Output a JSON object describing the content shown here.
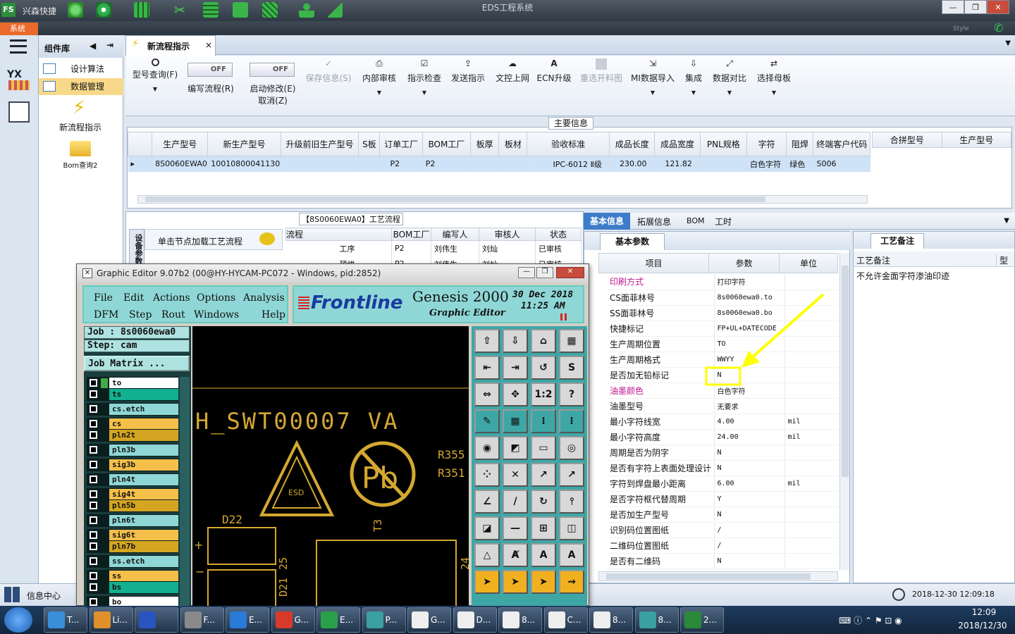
{
  "window": {
    "app_name": "兴森快捷",
    "title": "EDS工程系统",
    "style_label": "Style",
    "min": "—",
    "max": "❐",
    "close": "✕"
  },
  "sysmenu": {
    "label": "系统"
  },
  "left_rail": {
    "logo_text": "YX"
  },
  "component_panel": {
    "title": "组件库",
    "items": [
      {
        "label": "设计算法"
      },
      {
        "label": "数据管理"
      }
    ],
    "shortcuts": [
      {
        "label": "新流程指示"
      },
      {
        "label": "Bom查询2"
      }
    ]
  },
  "tab": {
    "label": "新流程指示",
    "close": "×"
  },
  "toolbar": {
    "buttons": [
      {
        "label": "型号查询(F)"
      },
      {
        "label": "编写流程(R)",
        "toggle": "OFF"
      },
      {
        "label": "启动修改(E)",
        "label2": "取消(Z)",
        "toggle": "OFF"
      },
      {
        "label": "保存信息(S)"
      },
      {
        "label": "内部审核"
      },
      {
        "label": "指示检查"
      },
      {
        "label": "发送指示"
      },
      {
        "label": "文控上网"
      },
      {
        "label": "ECN升级"
      },
      {
        "label": "重选开料图"
      },
      {
        "label": "MI数据导入"
      },
      {
        "label": "集成"
      },
      {
        "label": "数据对比"
      },
      {
        "label": "选择母板"
      }
    ]
  },
  "main_info": {
    "legend": "主要信息",
    "columns": [
      "生产型号",
      "新生产型号",
      "升级前旧生产型号",
      "S板",
      "订单工厂",
      "BOM工厂",
      "板厚",
      "板材",
      "验收标准",
      "成品长度",
      "成品宽度",
      "PNL规格",
      "字符",
      "阻焊",
      "终端客户代码"
    ],
    "row": [
      "8S0060EWA0",
      "10010800041130",
      "",
      "",
      "P2",
      "P2",
      "",
      "",
      "IPC-6012 Ⅱ级",
      "230.00",
      "121.82",
      "",
      "白色字符",
      "绿色",
      "S006"
    ],
    "side_columns": [
      "合拼型号",
      "生产型号"
    ]
  },
  "process": {
    "legend": "【8S0060EWA0】工艺流程",
    "hint": "单击节点加载工艺流程",
    "side_tab": "设备参数",
    "columns": [
      "流程",
      "BOM工厂",
      "编写人",
      "审核人",
      "状态"
    ],
    "rows": [
      {
        "name": "工序",
        "bom": "P2",
        "writer": "刘伟生",
        "checker": "刘灿",
        "status": "已审核"
      },
      {
        "name": "预烘",
        "bom": "P2",
        "writer": "刘伟生",
        "checker": "刘灿",
        "status": "已审核"
      }
    ]
  },
  "right_tabs": [
    "基本信息",
    "拓展信息",
    "BOM",
    "工时"
  ],
  "params": {
    "subtab": "基本参数",
    "columns": [
      "项目",
      "参数",
      "单位"
    ],
    "rows": [
      {
        "item": "印刷方式",
        "value": "打印字符",
        "unit": "",
        "hl": true
      },
      {
        "item": "CS面菲林号",
        "value": "8s0060ewa0.to",
        "unit": ""
      },
      {
        "item": "SS面菲林号",
        "value": "8s0060ewa0.bo",
        "unit": ""
      },
      {
        "item": "快捷标记",
        "value": "FP+UL+DATECODE",
        "unit": ""
      },
      {
        "item": "生产周期位置",
        "value": "TO",
        "unit": ""
      },
      {
        "item": "生产周期格式",
        "value": "WWYY",
        "unit": ""
      },
      {
        "item": "是否加无铅标记",
        "value": "N",
        "unit": ""
      },
      {
        "item": "油墨颜色",
        "value": "白色字符",
        "unit": "",
        "hl": true
      },
      {
        "item": "油墨型号",
        "value": "无要求",
        "unit": ""
      },
      {
        "item": "最小字符线宽",
        "value": "4.00",
        "unit": "mil"
      },
      {
        "item": "最小字符高度",
        "value": "24.00",
        "unit": "mil"
      },
      {
        "item": "周期是否为阴字",
        "value": "N",
        "unit": ""
      },
      {
        "item": "是否有字符上表面处理设计",
        "value": "N",
        "unit": ""
      },
      {
        "item": "字符到焊盘最小距离",
        "value": "6.00",
        "unit": "mil"
      },
      {
        "item": "是否字符框代替周期",
        "value": "Y",
        "unit": ""
      },
      {
        "item": "是否加生产型号",
        "value": "N",
        "unit": ""
      },
      {
        "item": "识别码位置图纸",
        "value": "/",
        "unit": ""
      },
      {
        "item": "二维码位置图纸",
        "value": "/",
        "unit": ""
      },
      {
        "item": "是否有二维码",
        "value": "N",
        "unit": ""
      }
    ]
  },
  "notes": {
    "tab": "工艺备注",
    "col1": "工艺备注",
    "col2": "型",
    "text": "不允许金面字符渗油印迹"
  },
  "statusbar": {
    "left": "信息中心",
    "datetime": "2018-12-30 12:09:18"
  },
  "genesis": {
    "title": "Graphic Editor 9.07b2 (00@HY-HYCAM-PC072 - Windows, pid:2852)",
    "menu": [
      "File",
      "Edit",
      "Actions",
      "Options",
      "Analysis",
      "DFM",
      "Step",
      "Rout",
      "Windows",
      "Help"
    ],
    "brand": "Frontline",
    "product": "Genesis 2000",
    "subtitle": "Graphic Editor",
    "date": "30 Dec 2018",
    "time": "11:25 AM",
    "job": "Job : 8s0060ewa0",
    "step": "Step: cam",
    "job_matrix": "Job Matrix ...",
    "layers": [
      {
        "name": "to",
        "color": "#ffffff"
      },
      {
        "name": "ts",
        "color": "#12b090"
      },
      {
        "name": "cs.etch",
        "color": "#8fd7d6"
      },
      {
        "name": "cs",
        "color": "#f5c04a"
      },
      {
        "name": "pln2t",
        "color": "#d4a520"
      },
      {
        "name": "pln3b",
        "color": "#8fd7d6"
      },
      {
        "name": "sig3b",
        "color": "#f5c04a"
      },
      {
        "name": "pln4t",
        "color": "#8fd7d6"
      },
      {
        "name": "sig4t",
        "color": "#f5c04a"
      },
      {
        "name": "pln5b",
        "color": "#d4a520"
      },
      {
        "name": "pln6t",
        "color": "#8fd7d6"
      },
      {
        "name": "sig6t",
        "color": "#f5c04a"
      },
      {
        "name": "pln7b",
        "color": "#d4a520"
      },
      {
        "name": "ss.etch",
        "color": "#8fd7d6"
      },
      {
        "name": "ss",
        "color": "#f5c04a"
      },
      {
        "name": "bs",
        "color": "#12b090"
      },
      {
        "name": "bo",
        "color": "#ffffff"
      }
    ],
    "canvas": {
      "text1": "H_SWT00007 VA",
      "esd": "ESD",
      "pb": "Pb",
      "r355": "R355",
      "r351": "R351",
      "d22": "D22",
      "t3": "T3",
      "d21": "D21",
      "n25": "25",
      "n24": "24",
      "plus": "+",
      "minus": "−"
    }
  },
  "taskbar": {
    "items": [
      "T...",
      "Li...",
      "",
      "F...",
      "E...",
      "G...",
      "E...",
      "P...",
      "G...",
      "D...",
      "8...",
      "C...",
      "8...",
      "8...",
      "2..."
    ],
    "time": "12:09",
    "date": "2018/12/30"
  },
  "colors": {
    "accent": "#3d7cc9",
    "highlight_text": "#c01890",
    "annotation": "#ffff00"
  }
}
